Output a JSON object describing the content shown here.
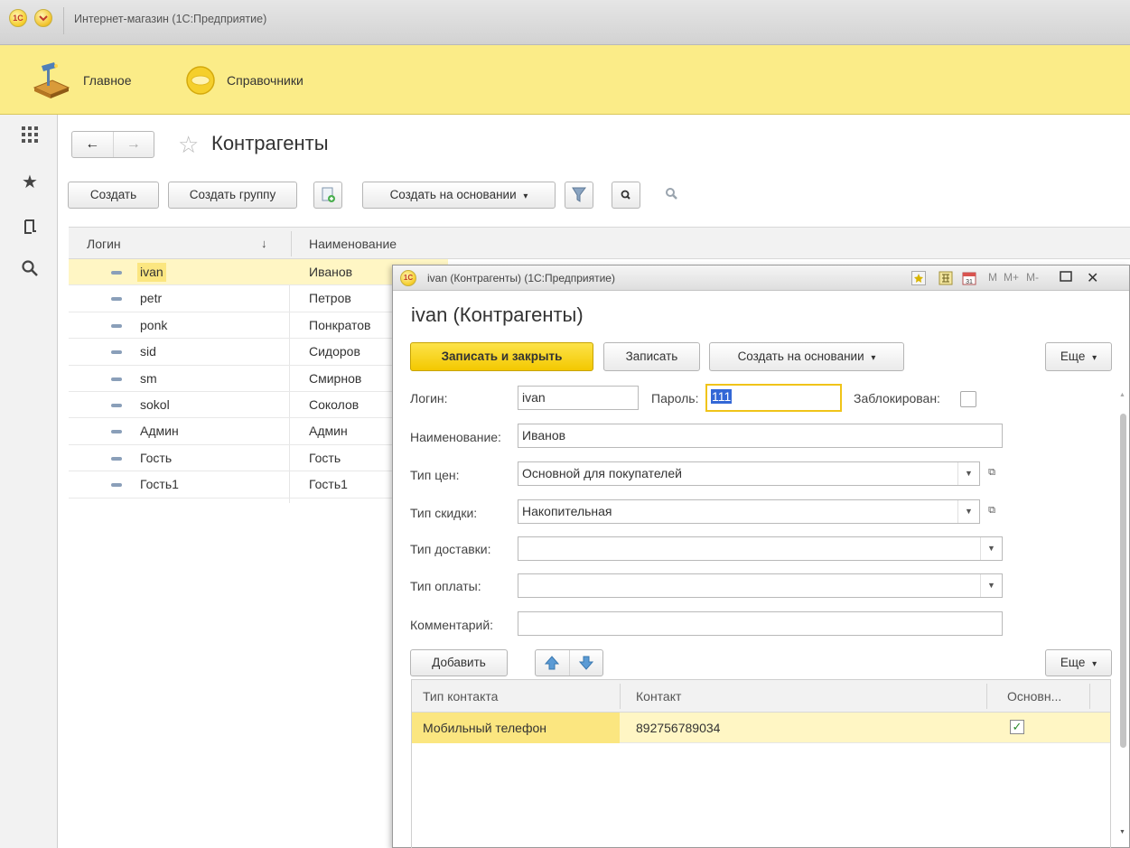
{
  "window": {
    "title": "Интернет-магазин (1С:Предприятие)"
  },
  "sections": [
    {
      "label": "Главное",
      "icon": "desk-lamp-icon"
    },
    {
      "label": "Справочники",
      "icon": "catalogs-icon"
    }
  ],
  "leftbar": [
    "apps-grid-icon",
    "star-icon",
    "history-icon",
    "search-icon"
  ],
  "list_form": {
    "title": "Контрагенты",
    "toolbar": {
      "create": "Создать",
      "create_group": "Создать группу",
      "create_based_on": "Создать на основании",
      "dropdown_marker": "▾"
    },
    "columns": {
      "login": "Логин",
      "sort_marker": "↓",
      "name": "Наименование"
    },
    "rows": [
      {
        "login": "ivan",
        "name": "Иванов"
      },
      {
        "login": "petr",
        "name": "Петров"
      },
      {
        "login": "ponk",
        "name": "Понкратов"
      },
      {
        "login": "sid",
        "name": "Сидоров"
      },
      {
        "login": "sm",
        "name": "Смирнов"
      },
      {
        "login": "sokol",
        "name": "Соколов"
      },
      {
        "login": "Админ",
        "name": "Админ"
      },
      {
        "login": "Гость",
        "name": "Гость"
      },
      {
        "login": "Гость1",
        "name": "Гость1"
      }
    ],
    "selected_row": 0
  },
  "dialog": {
    "window_title": "ivan (Контрагенты) (1С:Предприятие)",
    "heading": "ivan (Контрагенты)",
    "memory_buttons": {
      "m": "M",
      "m_plus": "M+",
      "m_minus": "M-"
    },
    "buttons": {
      "save_close": "Записать и закрыть",
      "save": "Записать",
      "create_based_on": "Создать на основании",
      "more": "Еще",
      "add": "Добавить",
      "more2": "Еще",
      "dropdown_marker": "▾"
    },
    "fields": {
      "login_label": "Логин:",
      "login_value": "ivan",
      "password_label": "Пароль:",
      "password_value": "111",
      "blocked_label": "Заблокирован:",
      "blocked_checked": false,
      "name_label": "Наименование:",
      "name_value": "Иванов",
      "price_type_label": "Тип цен:",
      "price_type_value": "Основной для покупателей",
      "discount_type_label": "Тип скидки:",
      "discount_type_value": "Накопительная",
      "delivery_type_label": "Тип доставки:",
      "delivery_type_value": "",
      "payment_type_label": "Тип оплаты:",
      "payment_type_value": "",
      "comment_label": "Комментарий:",
      "comment_value": ""
    },
    "contacts": {
      "columns": [
        "Тип контакта",
        "Контакт",
        "Основн..."
      ],
      "rows": [
        {
          "type": "Мобильный телефон",
          "contact": "892756789034",
          "main": true
        }
      ]
    }
  },
  "colors": {
    "accent_yellow": "#fbec88",
    "selection": "#fff6c4",
    "primary_button": "#f3c800"
  }
}
